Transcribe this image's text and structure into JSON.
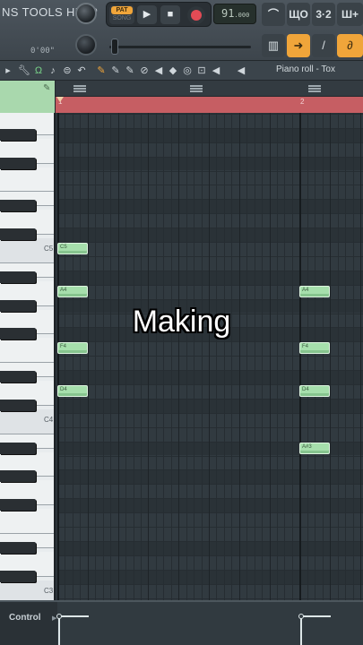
{
  "toolbar": {
    "menu_items": [
      "NS",
      "TOOLS",
      "HELP"
    ],
    "time_readout": "0'00\"",
    "pattern_label": "PAT",
    "song_label": "SONG",
    "play_icon": "▶",
    "stop_icon": "■",
    "tempo_value": "91",
    "tempo_fraction": ".000",
    "icons": [
      "tilde-up-icon",
      "wave-icon",
      "counter-icon",
      "plus-wave-icon"
    ],
    "icon_glyphs": [
      "⌒",
      "ЩO",
      "3·2",
      "Ш+"
    ],
    "midi_buttons": [
      "keyboard-icon",
      "arrow-right-icon",
      "pen-icon",
      "link-icon"
    ],
    "midi_glyphs": [
      "▥",
      "➜",
      "/",
      "∂"
    ]
  },
  "piano_roll": {
    "title": "Piano roll - Tox",
    "tools": [
      "▸",
      "↕",
      "Ω",
      "♪",
      "⊜",
      "↶",
      "✎",
      "✎",
      "✎",
      "⊘",
      "◀",
      "◆",
      "◎",
      "⊡",
      "◀",
      "◀"
    ],
    "bar_labels": [
      "1",
      "2"
    ],
    "keyboard_labels": [
      {
        "name": "C5",
        "text": "C5"
      },
      {
        "name": "C4",
        "text": "C4"
      },
      {
        "name": "C3",
        "text": "C3"
      }
    ],
    "notes": [
      {
        "label": "C5",
        "beat": 0,
        "len": 1,
        "row": "C5"
      },
      {
        "label": "A4",
        "beat": 0,
        "len": 1,
        "row": "A4"
      },
      {
        "label": "F4",
        "beat": 0,
        "len": 1,
        "row": "F4"
      },
      {
        "label": "D4",
        "beat": 0,
        "len": 1,
        "row": "D4"
      },
      {
        "label": "A4",
        "beat": 8,
        "len": 1,
        "row": "A4"
      },
      {
        "label": "F4",
        "beat": 8,
        "len": 1,
        "row": "F4"
      },
      {
        "label": "D4",
        "beat": 8,
        "len": 1,
        "row": "D4"
      },
      {
        "label": "A#3",
        "beat": 8,
        "len": 1,
        "row": "A#3"
      }
    ]
  },
  "overlay": {
    "caption": "Making"
  },
  "control": {
    "label": "Control"
  },
  "colors": {
    "accent": "#f0a53a",
    "note": "#a6dfac",
    "timeline": "#c65e63",
    "record": "#e24b55"
  }
}
